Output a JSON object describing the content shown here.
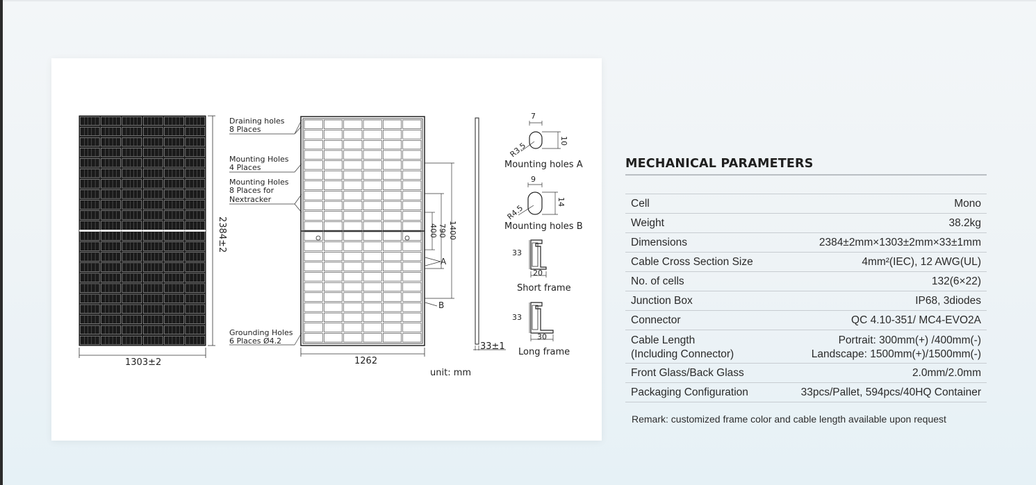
{
  "drawing": {
    "labels": {
      "draining_holes": [
        "Draining holes",
        "8 Places"
      ],
      "mounting_holes_a": [
        "Mounting Holes",
        "4 Places"
      ],
      "mounting_holes_b": [
        "Mounting Holes",
        "8 Places for",
        "Nextracker"
      ],
      "grounding_holes": [
        "Grounding Holes",
        "6 Places Ø4.2"
      ],
      "height_dim": "2384±2",
      "width_dim": "1303±2",
      "inner_width_dim": "1262",
      "dim_400": "400",
      "dim_790": "790",
      "dim_1400": "1400",
      "callout_a": "A",
      "callout_b": "B",
      "thickness_dim": "33±1",
      "unit": "unit: mm"
    },
    "details": {
      "mount_a_caption": "Mounting holes A",
      "mount_a_w": "7",
      "mount_a_h": "10",
      "mount_a_r": "R3.5",
      "mount_b_caption": "Mounting holes B",
      "mount_b_w": "9",
      "mount_b_h": "14",
      "mount_b_r": "R4.5",
      "short_frame_caption": "Short frame",
      "short_frame_h": "33",
      "short_frame_w": "20",
      "long_frame_caption": "Long frame",
      "long_frame_h": "33",
      "long_frame_w": "30"
    }
  },
  "params": {
    "title": "MECHANICAL PARAMETERS",
    "rows": [
      {
        "k": "Cell",
        "v": "Mono"
      },
      {
        "k": "Weight",
        "v": "38.2kg"
      },
      {
        "k": "Dimensions",
        "v": "2384±2mm×1303±2mm×33±1mm"
      },
      {
        "k": "Cable Cross Section Size",
        "v": "4mm²(IEC), 12 AWG(UL)"
      },
      {
        "k": "No. of cells",
        "v": "132(6×22)"
      },
      {
        "k": "Junction Box",
        "v": "IP68, 3diodes"
      },
      {
        "k": "Connector",
        "v": "QC 4.10-351/ MC4-EVO2A"
      },
      {
        "k": "Cable Length",
        "k2": "(Including Connector)",
        "v": "Portrait: 300mm(+) /400mm(-)",
        "v2": "Landscape: 1500mm(+)/1500mm(-)"
      },
      {
        "k": "Front Glass/Back Glass",
        "v": "2.0mm/2.0mm"
      },
      {
        "k": "Packaging Configuration",
        "v": "33pcs/Pallet, 594pcs/40HQ Container"
      }
    ],
    "remark": "Remark: customized frame color and cable length available upon request"
  }
}
